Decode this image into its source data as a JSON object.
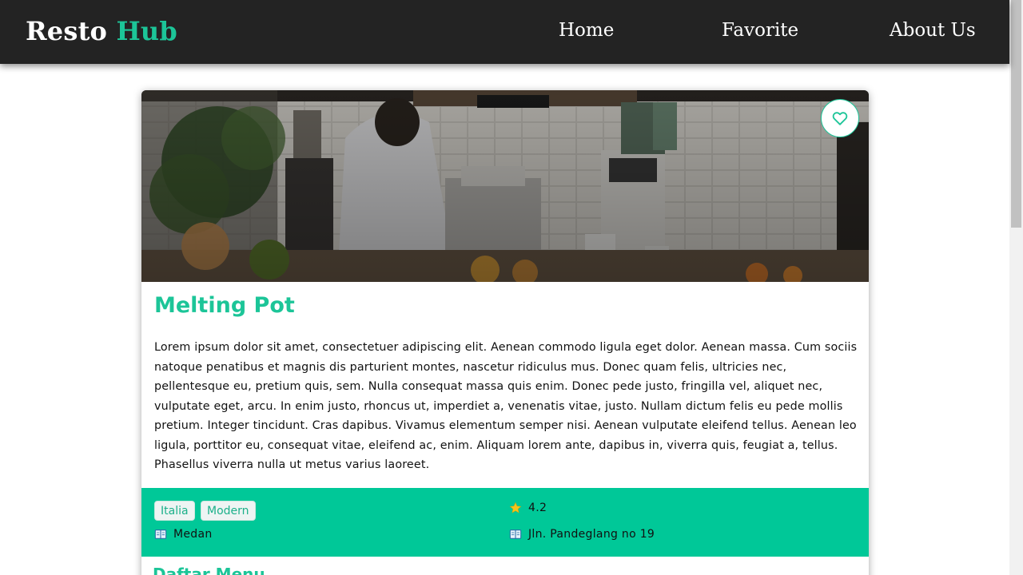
{
  "brand": {
    "part1": "Resto",
    "part2": "Hub"
  },
  "nav": {
    "home": "Home",
    "favorite": "Favorite",
    "about": "About Us"
  },
  "restaurant": {
    "name": "Melting Pot",
    "description": "Lorem ipsum dolor sit amet, consectetuer adipiscing elit. Aenean commodo ligula eget dolor. Aenean massa. Cum sociis natoque penatibus et magnis dis parturient montes, nascetur ridiculus mus. Donec quam felis, ultricies nec, pellentesque eu, pretium quis, sem. Nulla consequat massa quis enim. Donec pede justo, fringilla vel, aliquet nec, vulputate eget, arcu. In enim justo, rhoncus ut, imperdiet a, venenatis vitae, justo. Nullam dictum felis eu pede mollis pretium. Integer tincidunt. Cras dapibus. Vivamus elementum semper nisi. Aenean vulputate eleifend tellus. Aenean leo ligula, porttitor eu, consequat vitae, eleifend ac, enim. Aliquam lorem ante, dapibus in, viverra quis, feugiat a, tellus. Phasellus viverra nulla ut metus varius laoreet.",
    "categories": [
      "Italia",
      "Modern"
    ],
    "rating": "4.2",
    "city": "Medan",
    "address": "Jln. Pandeglang no 19"
  },
  "menu": {
    "heading": "Daftar Menu"
  },
  "icons": {
    "favorite": "heart-outline-icon",
    "rating": "star-icon",
    "city": "book-map-icon",
    "address": "book-map-icon"
  },
  "colors": {
    "accent": "#1cc598",
    "navbar": "#232323",
    "info_bar": "#00c898",
    "star": "#f6c31a"
  }
}
